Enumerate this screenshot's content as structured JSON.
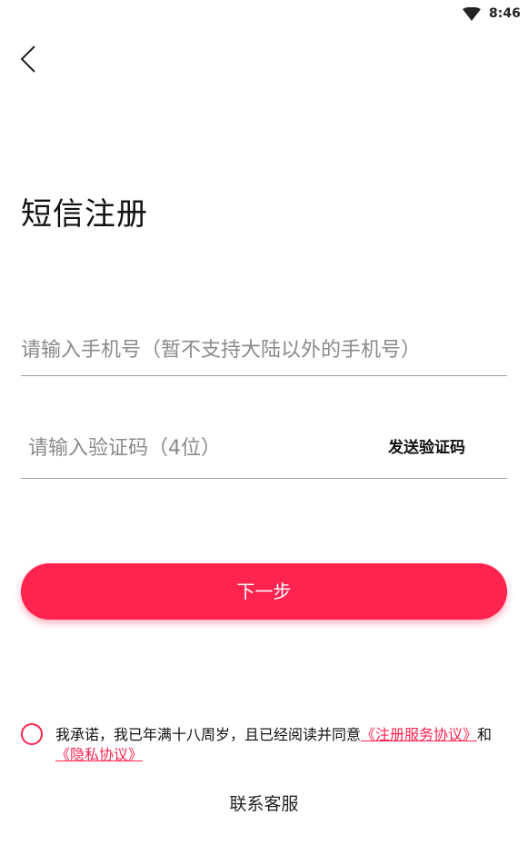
{
  "status_bar": {
    "time": "8:46",
    "wifi_icon": "wifi-icon"
  },
  "nav": {
    "back_icon": "back-chevron-icon"
  },
  "page": {
    "title": "短信注册"
  },
  "form": {
    "phone_placeholder": "请输入手机号（暂不支持大陆以外的手机号）",
    "phone_value": "",
    "code_placeholder": "请输入验证码（4位）",
    "code_value": "",
    "send_code_label": "发送验证码"
  },
  "actions": {
    "next_label": "下一步"
  },
  "agreement": {
    "checked": false,
    "prefix": "我承诺，我已年满十八周岁，且已经阅读并同意",
    "terms_link": "《注册服务协议》",
    "and": "和",
    "privacy_link": "《隐私协议》"
  },
  "footer": {
    "contact_label": "联系客服"
  },
  "colors": {
    "accent": "#ff2350",
    "divider": "#9e9e9e"
  }
}
